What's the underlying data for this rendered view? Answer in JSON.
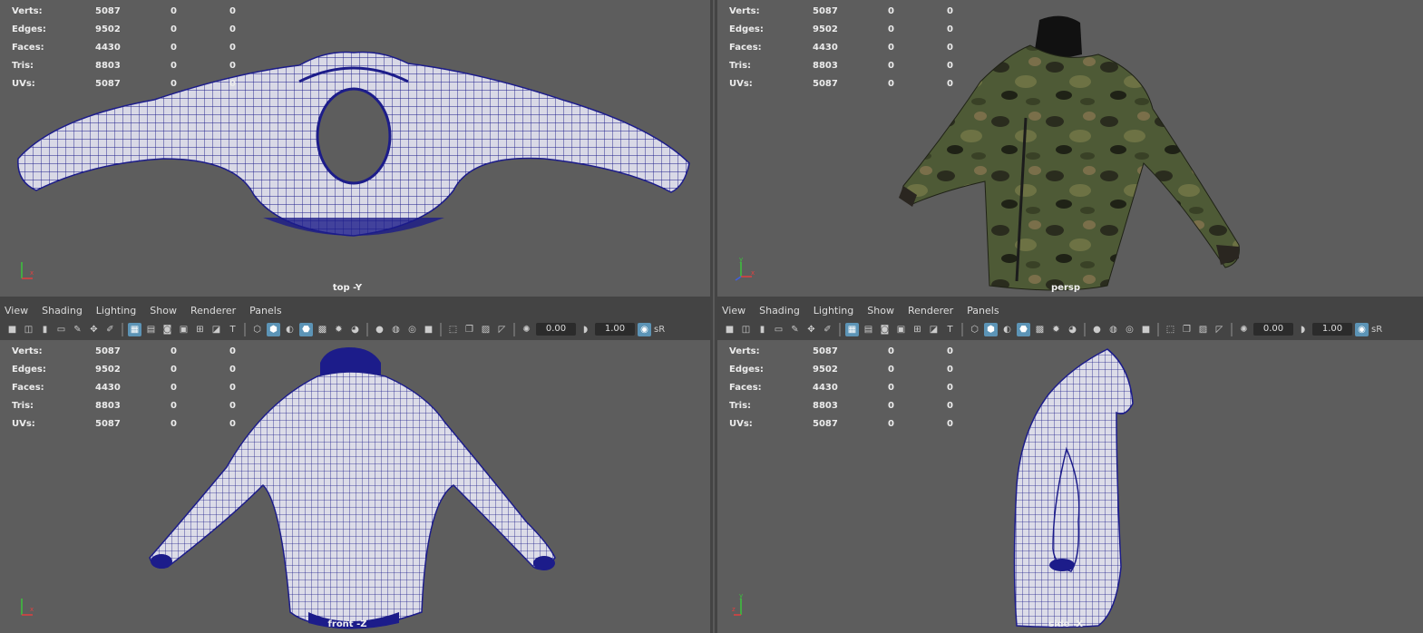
{
  "hud": {
    "labels": [
      "Verts:",
      "Edges:",
      "Faces:",
      "Tris:",
      "UVs:"
    ],
    "values": [
      [
        "5087",
        "0",
        "0"
      ],
      [
        "9502",
        "0",
        "0"
      ],
      [
        "4430",
        "0",
        "0"
      ],
      [
        "8803",
        "0",
        "0"
      ],
      [
        "5087",
        "0",
        "0"
      ]
    ]
  },
  "viewports": {
    "top": {
      "camera": "top -Y"
    },
    "persp": {
      "camera": "persp"
    },
    "front": {
      "camera": "front -Z"
    },
    "side": {
      "camera": "side -X"
    }
  },
  "panel_menu": [
    "View",
    "Shading",
    "Lighting",
    "Show",
    "Renderer",
    "Panels"
  ],
  "toolbar": {
    "exposure": "0.00",
    "gamma": "1.00",
    "color_space": "sR"
  },
  "colors": {
    "viewport_bg": "#5d5d5d",
    "wire": "#2a2a9e",
    "accent": "#5c94b6"
  }
}
